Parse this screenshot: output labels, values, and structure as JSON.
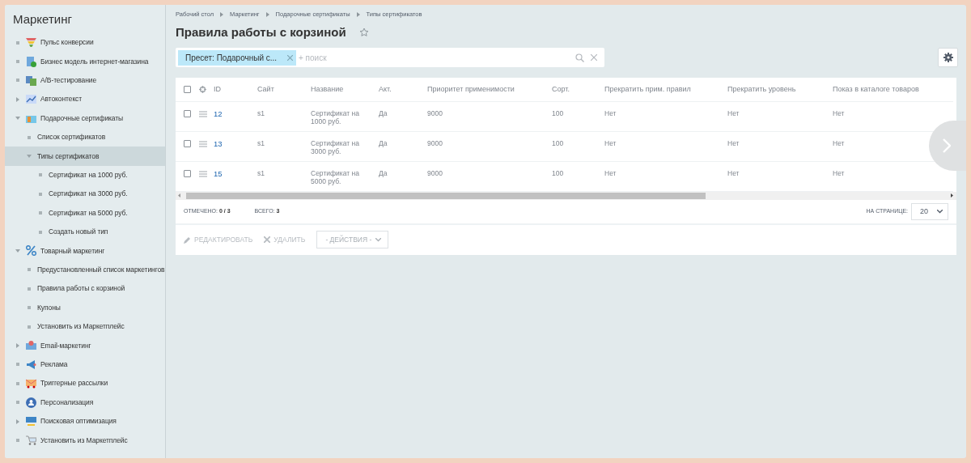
{
  "sidebar": {
    "title": "Маркетинг",
    "items": [
      {
        "label": "Пульс конверсии",
        "kind": "leaf",
        "selected": false
      },
      {
        "label": "Бизнес модель интернет-магазина",
        "kind": "leaf",
        "selected": false
      },
      {
        "label": "A/B-тестирование",
        "kind": "leaf",
        "selected": false
      },
      {
        "label": "Автоконтекст",
        "kind": "group",
        "expanded": false,
        "selected": false
      },
      {
        "label": "Подарочные сертификаты",
        "kind": "group",
        "expanded": true,
        "selected": false,
        "children": [
          {
            "label": "Список сертификатов",
            "kind": "leaf",
            "selected": false
          },
          {
            "label": "Типы сертификатов",
            "kind": "group",
            "expanded": true,
            "selected": true,
            "children": [
              {
                "label": "Сертификат на 1000 руб.",
                "kind": "leaf",
                "selected": false
              },
              {
                "label": "Сертификат на 3000 руб.",
                "kind": "leaf",
                "selected": false
              },
              {
                "label": "Сертификат на 5000 руб.",
                "kind": "leaf",
                "selected": false
              },
              {
                "label": "Создать новый тип",
                "kind": "leaf",
                "selected": false
              }
            ]
          }
        ]
      },
      {
        "label": "Товарный маркетинг",
        "kind": "group",
        "expanded": true,
        "selected": false,
        "children": [
          {
            "label": "Предустановленный список маркетингов",
            "kind": "leaf",
            "selected": false
          },
          {
            "label": "Правила работы с корзиной",
            "kind": "leaf",
            "selected": false
          },
          {
            "label": "Купоны",
            "kind": "leaf",
            "selected": false
          },
          {
            "label": "Установить из Маркетплейс",
            "kind": "leaf",
            "selected": false
          }
        ]
      },
      {
        "label": "Email-маркетинг",
        "kind": "group",
        "expanded": false,
        "selected": false
      },
      {
        "label": "Реклама",
        "kind": "leaf",
        "selected": false
      },
      {
        "label": "Триггерные рассылки",
        "kind": "leaf",
        "selected": false
      },
      {
        "label": "Персонализация",
        "kind": "leaf",
        "selected": false
      },
      {
        "label": "Поисковая оптимизация",
        "kind": "group",
        "expanded": false,
        "selected": false
      },
      {
        "label": "Установить из Маркетплейс",
        "kind": "leaf",
        "selected": false
      }
    ]
  },
  "breadcrumbs": [
    "Рабочий стол",
    "Маркетинг",
    "Подарочные сертификаты",
    "Типы сертификатов"
  ],
  "page_title": "Правила работы с корзиной",
  "filter": {
    "preset": "Пресет: Подарочный с...",
    "placeholder": "+ поиск"
  },
  "table": {
    "select_all_checked": false,
    "columns": [
      "ID",
      "Сайт",
      "Название",
      "Акт.",
      "Приоритет применимости",
      "Сорт.",
      "Прекратить прим. правил",
      "Прекратить уровень",
      "Показ в каталоге товаров"
    ],
    "rows": [
      {
        "checked": false,
        "cells": [
          "12",
          "s1",
          "Сертификат на 1000 руб.",
          "Да",
          "9000",
          "100",
          "Нет",
          "Нет",
          "Нет"
        ]
      },
      {
        "checked": false,
        "cells": [
          "13",
          "s1",
          "Сертификат на 3000 руб.",
          "Да",
          "9000",
          "100",
          "Нет",
          "Нет",
          "Нет"
        ]
      },
      {
        "checked": false,
        "cells": [
          "15",
          "s1",
          "Сертификат на 5000 руб.",
          "Да",
          "9000",
          "100",
          "Нет",
          "Нет",
          "Нет"
        ]
      }
    ]
  },
  "footer": {
    "checked_label": "ОТМЕЧЕНО:",
    "checked_value": "0 / 3",
    "total_label": "ВСЕГО:",
    "total_value": "3",
    "per_page_label": "НА СТРАНИЦЕ:",
    "per_page": "20"
  },
  "actions": [
    {
      "kind": "edit",
      "label": "РЕДАКТИРОВАТЬ",
      "disabled": true
    },
    {
      "kind": "delete",
      "label": "УДАЛИТЬ",
      "disabled": true
    },
    {
      "kind": "dropdown",
      "label": "- ДЕЙСТВИЯ -"
    }
  ]
}
